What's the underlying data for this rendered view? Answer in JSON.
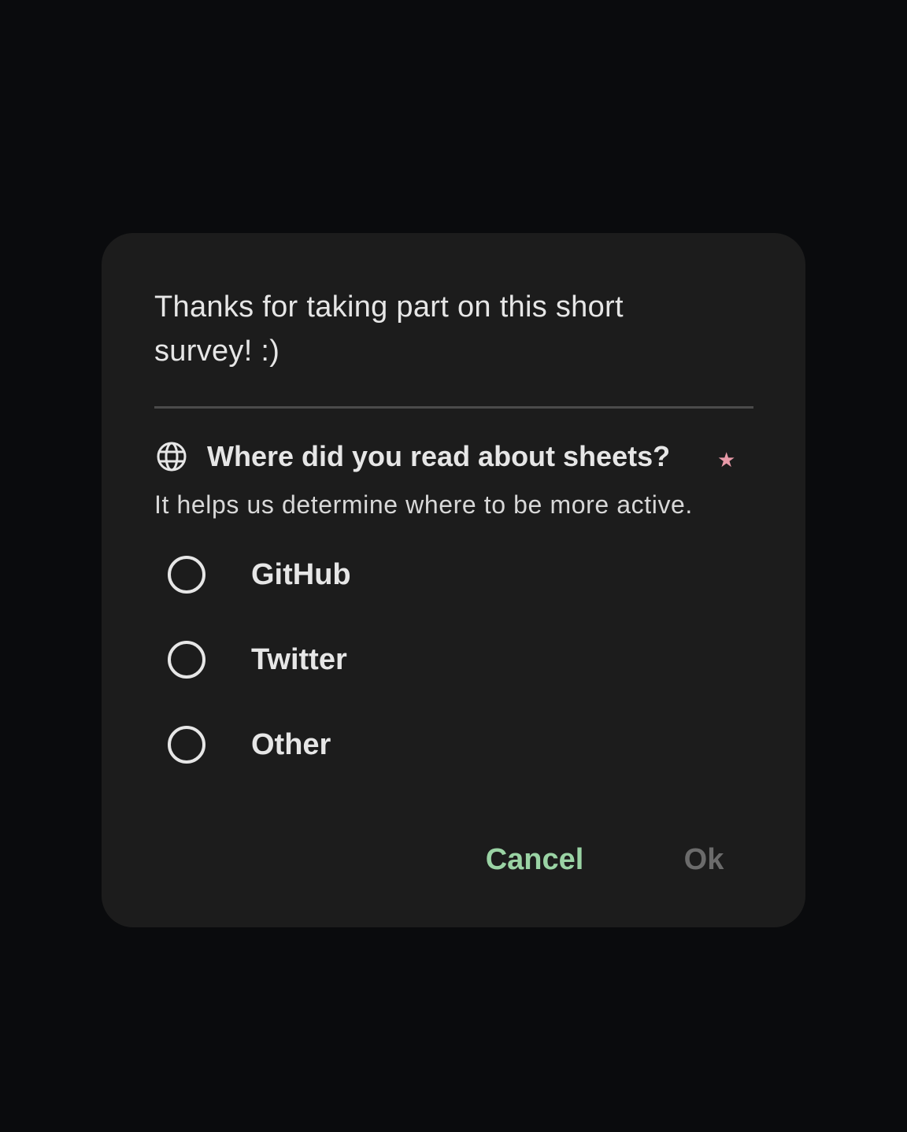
{
  "dialog": {
    "title": "Thanks for taking part on this short survey! :)",
    "question": {
      "icon": "globe-icon",
      "text": "Where did you read about sheets?",
      "required_mark": "★",
      "hint": "It helps us determine where to be more active."
    },
    "options": [
      {
        "label": "GitHub",
        "selected": false
      },
      {
        "label": "Twitter",
        "selected": false
      },
      {
        "label": "Other",
        "selected": false
      }
    ],
    "actions": {
      "cancel_label": "Cancel",
      "ok_label": "Ok",
      "ok_enabled": false
    }
  },
  "colors": {
    "background": "#0a0b0d",
    "dialog": "#1c1c1c",
    "text": "#e6e6e6",
    "accent": "#9ad3a4",
    "disabled": "#6b6b6b",
    "required": "#e89aa8"
  }
}
